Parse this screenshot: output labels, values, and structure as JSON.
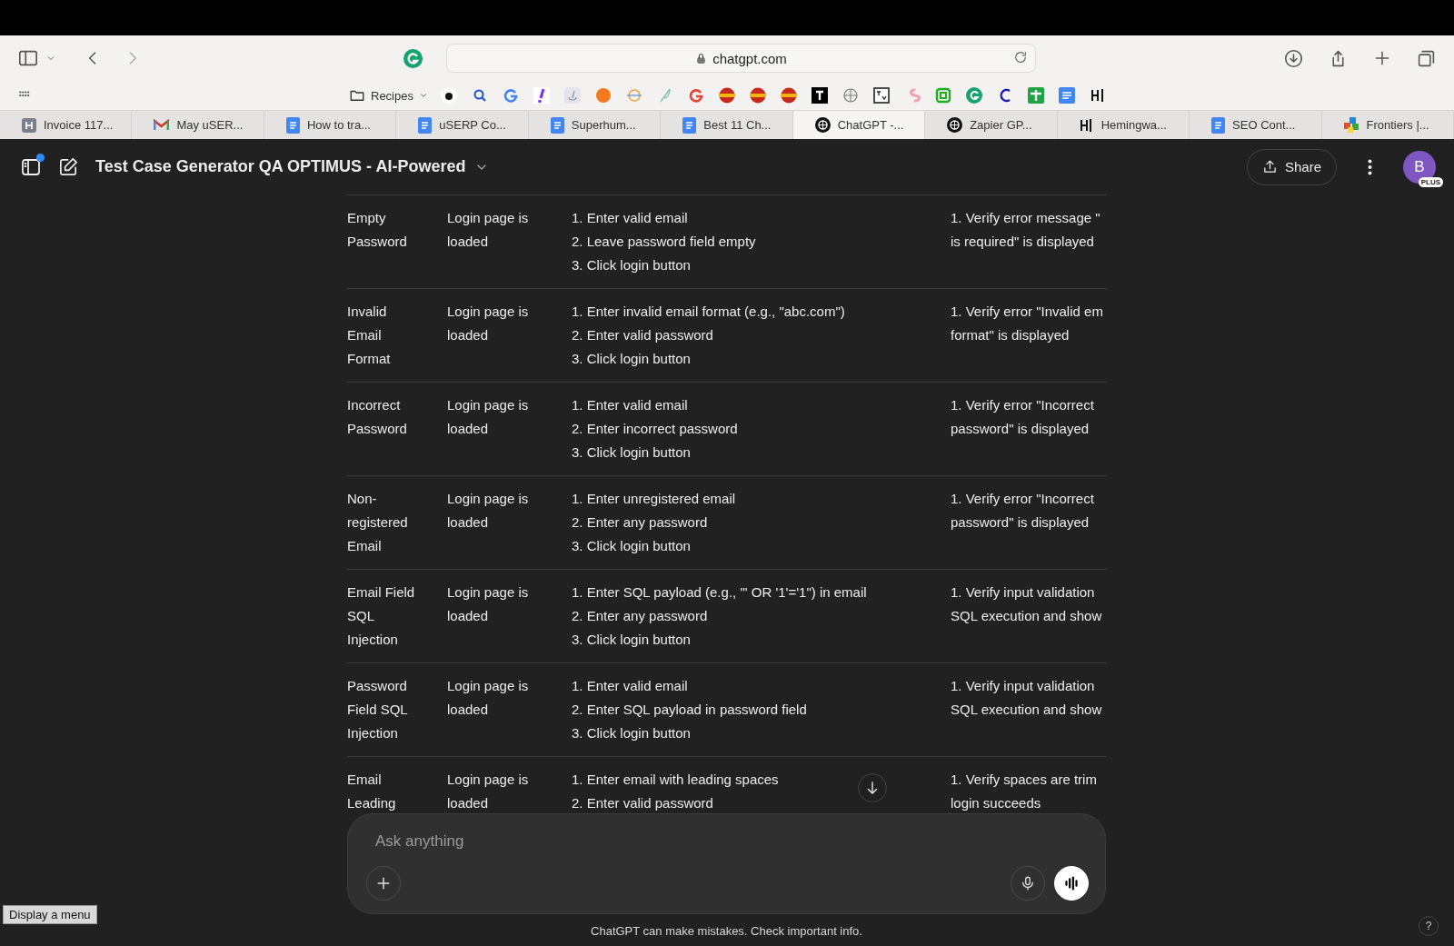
{
  "browser": {
    "url": "chatgpt.com",
    "bookmarks_folder": "Recipes"
  },
  "tabs": [
    {
      "title": "Invoice 117...",
      "selected": false
    },
    {
      "title": "May uSER...",
      "selected": false
    },
    {
      "title": "How to tra...",
      "selected": false
    },
    {
      "title": "uSERP Co...",
      "selected": false
    },
    {
      "title": "Superhum...",
      "selected": false
    },
    {
      "title": "Best 11 Ch...",
      "selected": false
    },
    {
      "title": "ChatGPT -...",
      "selected": true
    },
    {
      "title": "Zapier GP...",
      "selected": false
    },
    {
      "title": "Hemingwa...",
      "selected": false
    },
    {
      "title": "SEO Cont...",
      "selected": false
    },
    {
      "title": "Frontiers |...",
      "selected": false
    }
  ],
  "header": {
    "title": "Test Case Generator QA OPTIMUS - AI-Powered",
    "share": "Share",
    "avatar": "B",
    "plan": "PLUS"
  },
  "table": {
    "rows": [
      {
        "scenario": "Empty Password",
        "precondition": "Login page is loaded",
        "steps": [
          "1. Enter valid email",
          "2. Leave password field empty",
          "3. Click login button"
        ],
        "expected": [
          "1. Verify error message \"",
          "is required\" is displayed"
        ]
      },
      {
        "scenario": "Invalid Email Format",
        "precondition": "Login page is loaded",
        "steps": [
          "1. Enter invalid email format (e.g., \"abc.com\")",
          "2. Enter valid password",
          "3. Click login button"
        ],
        "expected": [
          "1. Verify error \"Invalid em",
          "format\" is displayed"
        ]
      },
      {
        "scenario": "Incorrect Password",
        "precondition": "Login page is loaded",
        "steps": [
          "1. Enter valid email",
          "2. Enter incorrect password",
          "3. Click login button"
        ],
        "expected": [
          "1. Verify error \"Incorrect",
          "password\" is displayed"
        ]
      },
      {
        "scenario": "Non-registered Email",
        "precondition": "Login page is loaded",
        "steps": [
          "1. Enter unregistered email",
          "2. Enter any password",
          "3. Click login button"
        ],
        "expected": [
          "1. Verify error \"Incorrect",
          "password\" is displayed"
        ]
      },
      {
        "scenario": "Email Field SQL Injection",
        "precondition": "Login page is loaded",
        "steps": [
          "1. Enter SQL payload (e.g., \"' OR '1'='1\") in email",
          "2. Enter any password",
          "3. Click login button"
        ],
        "expected": [
          "1. Verify input validation",
          "SQL execution and show"
        ]
      },
      {
        "scenario": "Password Field SQL Injection",
        "precondition": "Login page is loaded",
        "steps": [
          "1. Enter valid email",
          "2. Enter SQL payload in password field",
          "3. Click login button"
        ],
        "expected": [
          "1. Verify input validation",
          "SQL execution and show"
        ]
      },
      {
        "scenario": "Email Leading",
        "precondition": "Login page is loaded",
        "steps": [
          "1. Enter email with leading spaces",
          "2. Enter valid password"
        ],
        "expected": [
          "1. Verify spaces are trim",
          "login succeeds"
        ]
      }
    ]
  },
  "composer": {
    "placeholder": "Ask anything"
  },
  "disclaimer": "ChatGPT can make mistakes. Check important info.",
  "help": "?",
  "tooltip": "Display a menu"
}
